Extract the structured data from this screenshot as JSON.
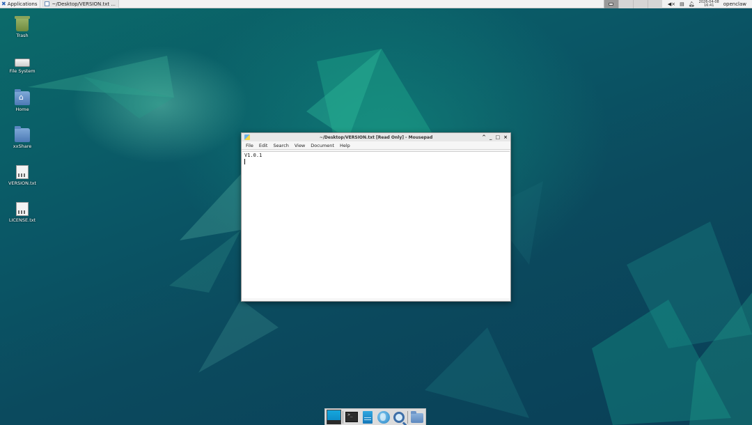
{
  "top_panel": {
    "applications_label": "Applications",
    "task_label": "~/Desktop/VERSION.txt ...",
    "clock_date": "2026-04-08",
    "clock_time": "16:41",
    "user_label": "openclaw"
  },
  "desktop": {
    "icons": [
      {
        "label": "Trash",
        "icon": "trash-icon"
      },
      {
        "label": "File System",
        "icon": "drive-icon"
      },
      {
        "label": "Home",
        "icon": "home-folder-icon"
      },
      {
        "label": "xxShare",
        "icon": "folder-icon"
      },
      {
        "label": "VERSION.txt",
        "icon": "text-file-icon"
      },
      {
        "label": "LICENSE.txt",
        "icon": "text-file-icon"
      }
    ]
  },
  "window": {
    "title": "~/Desktop/VERSION.txt [Read Only] - Mousepad",
    "menu": [
      "File",
      "Edit",
      "Search",
      "View",
      "Document",
      "Help"
    ],
    "content": "V1.0.1"
  },
  "dock": {
    "items": [
      "show-desktop-icon",
      "terminal-icon",
      "file-manager-icon",
      "web-browser-icon",
      "search-icon",
      "folder-icon"
    ],
    "terminal_prompt": ">_"
  }
}
